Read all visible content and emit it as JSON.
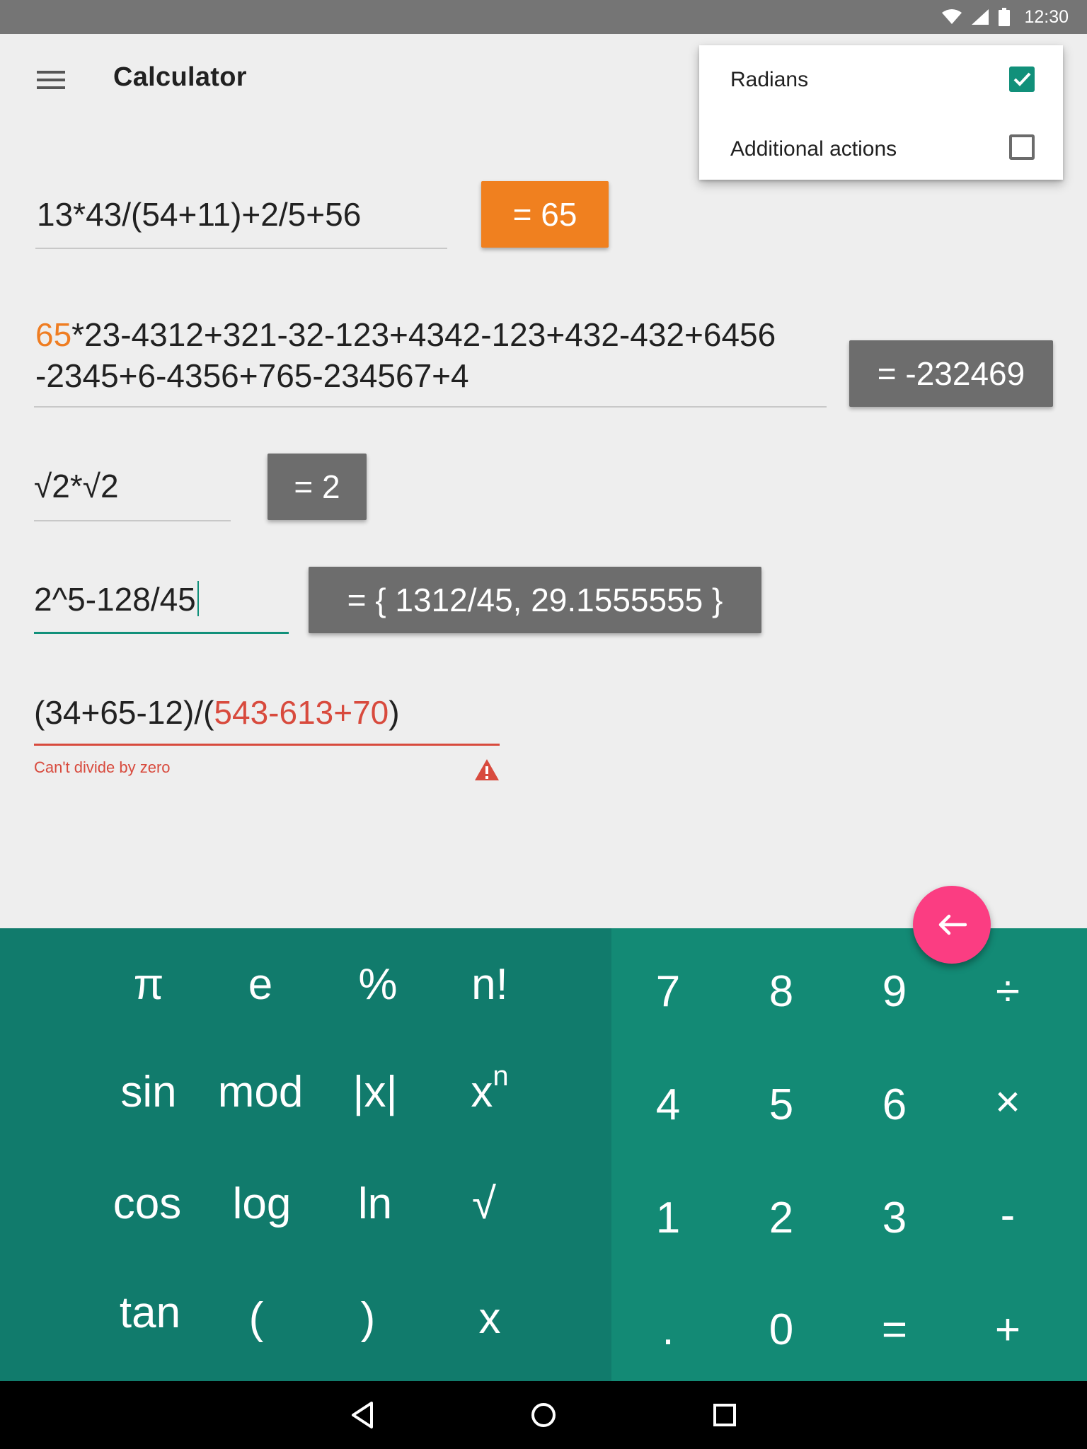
{
  "status": {
    "time": "12:30"
  },
  "app": {
    "title": "Calculator"
  },
  "menu": {
    "items": [
      {
        "label": "Radians",
        "checked": true
      },
      {
        "label": "Additional actions",
        "checked": false
      }
    ]
  },
  "calculations": [
    {
      "expression": "13*43/(54+11)+2/5+56",
      "result": "= 65"
    },
    {
      "expression_highlight": "65",
      "expression_line1": "*23-4312+321-32-123+4342-123+432-432+6456",
      "expression_line2": "-2345+6-4356+765-234567+4",
      "result": "= -232469"
    },
    {
      "expression": "√2*√2",
      "result": "= 2"
    },
    {
      "expression": "2^5-128/45",
      "result": "= { 1312/45, 29.1555555 }"
    },
    {
      "expression_prefix": "(34+65-12)/(",
      "expression_error": "543-613+70",
      "expression_suffix": ")",
      "error": "Can't divide by zero"
    }
  ],
  "keypad": {
    "functions": [
      [
        "π",
        "e",
        "%",
        "n!"
      ],
      [
        "sin",
        "mod",
        "|x|",
        "x"
      ],
      [
        "cos",
        "log",
        "ln",
        "√"
      ],
      [
        "tan",
        "(",
        ")",
        "x"
      ]
    ],
    "power_superscript": "n",
    "digits": [
      [
        "7",
        "8",
        "9",
        "÷"
      ],
      [
        "4",
        "5",
        "6",
        "×"
      ],
      [
        "1",
        "2",
        "3",
        "-"
      ],
      [
        ".",
        "0",
        "=",
        "+"
      ]
    ]
  },
  "colors": {
    "accent": "#11907a",
    "result_highlight": "#f0801f",
    "result_default": "#6d6d6d",
    "error": "#d84a3d",
    "fab": "#fb3d82"
  },
  "icons": [
    "wifi-icon",
    "signal-icon",
    "battery-icon",
    "menu-icon",
    "checkbox-checked-icon",
    "checkbox-unchecked-icon",
    "warning-icon",
    "backspace-arrow-icon",
    "nav-back-icon",
    "nav-home-icon",
    "nav-recents-icon"
  ]
}
